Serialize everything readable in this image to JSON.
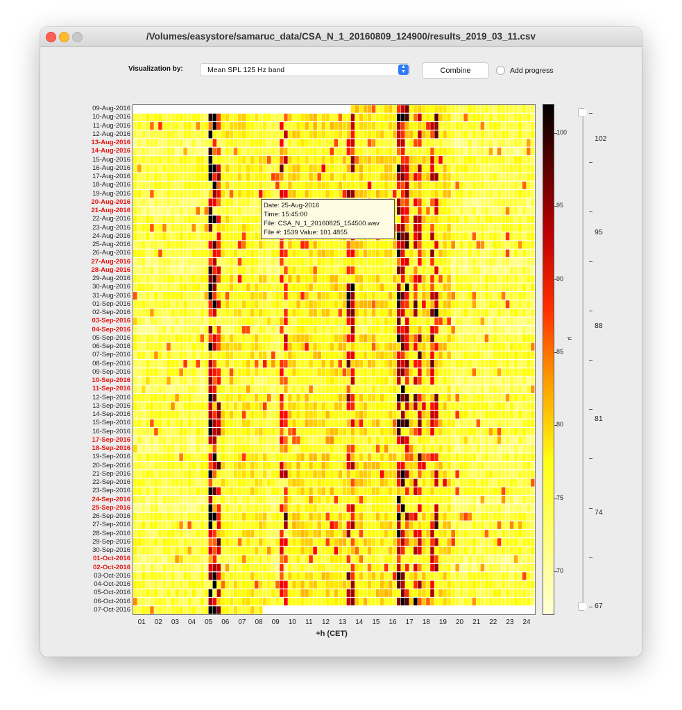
{
  "window": {
    "title": "/Volumes/easystore/samaruc_data/CSA_N_1_20160809_124900/results_2019_03_11.csv"
  },
  "controls": {
    "visualization_label": "Visualization by:",
    "visualization_selected": "Mean SPL 125 Hz band",
    "combine_label": "Combine",
    "add_progress_label": "Add progress",
    "add_progress_checked": false
  },
  "tooltip": {
    "date": "Date: 25-Aug-2016",
    "time": "Time: 15:45:00",
    "file": "File: CSA_N_1_20160825_154500.wav",
    "file_num": "File #: 1539 Value: 101.4855"
  },
  "colorbar": {
    "axis_title": "μ"
  },
  "slider": {
    "labels": [
      "102",
      "95",
      "88",
      "81",
      "74",
      "67"
    ]
  },
  "colors": {
    "weekend_label": "#e8130d"
  },
  "chart_data": {
    "type": "heatmap",
    "title": "",
    "xlabel": "+h (CET)",
    "ylabel": "",
    "x_ticks": [
      "01",
      "02",
      "03",
      "04",
      "05",
      "06",
      "07",
      "08",
      "09",
      "10",
      "11",
      "12",
      "13",
      "14",
      "15",
      "16",
      "17",
      "18",
      "19",
      "20",
      "21",
      "22",
      "23",
      "24"
    ],
    "rows": [
      {
        "label": "09-Aug-2016",
        "weekend": false
      },
      {
        "label": "10-Aug-2016",
        "weekend": false
      },
      {
        "label": "11-Aug-2016",
        "weekend": false
      },
      {
        "label": "12-Aug-2016",
        "weekend": false
      },
      {
        "label": "13-Aug-2016",
        "weekend": true
      },
      {
        "label": "14-Aug-2016",
        "weekend": true
      },
      {
        "label": "15-Aug-2016",
        "weekend": false
      },
      {
        "label": "16-Aug-2016",
        "weekend": false
      },
      {
        "label": "17-Aug-2016",
        "weekend": false
      },
      {
        "label": "18-Aug-2016",
        "weekend": false
      },
      {
        "label": "19-Aug-2016",
        "weekend": false
      },
      {
        "label": "20-Aug-2016",
        "weekend": true
      },
      {
        "label": "21-Aug-2016",
        "weekend": true
      },
      {
        "label": "22-Aug-2016",
        "weekend": false
      },
      {
        "label": "23-Aug-2016",
        "weekend": false
      },
      {
        "label": "24-Aug-2016",
        "weekend": false
      },
      {
        "label": "25-Aug-2016",
        "weekend": false
      },
      {
        "label": "26-Aug-2016",
        "weekend": false
      },
      {
        "label": "27-Aug-2016",
        "weekend": true
      },
      {
        "label": "28-Aug-2016",
        "weekend": true
      },
      {
        "label": "29-Aug-2016",
        "weekend": false
      },
      {
        "label": "30-Aug-2016",
        "weekend": false
      },
      {
        "label": "31-Aug-2016",
        "weekend": false
      },
      {
        "label": "01-Sep-2016",
        "weekend": false
      },
      {
        "label": "02-Sep-2016",
        "weekend": false
      },
      {
        "label": "03-Sep-2016",
        "weekend": true
      },
      {
        "label": "04-Sep-2016",
        "weekend": true
      },
      {
        "label": "05-Sep-2016",
        "weekend": false
      },
      {
        "label": "06-Sep-2016",
        "weekend": false
      },
      {
        "label": "07-Sep-2016",
        "weekend": false
      },
      {
        "label": "08-Sep-2016",
        "weekend": false
      },
      {
        "label": "09-Sep-2016",
        "weekend": false
      },
      {
        "label": "10-Sep-2016",
        "weekend": true
      },
      {
        "label": "11-Sep-2016",
        "weekend": true
      },
      {
        "label": "12-Sep-2016",
        "weekend": false
      },
      {
        "label": "13-Sep-2016",
        "weekend": false
      },
      {
        "label": "14-Sep-2016",
        "weekend": false
      },
      {
        "label": "15-Sep-2016",
        "weekend": false
      },
      {
        "label": "16-Sep-2016",
        "weekend": false
      },
      {
        "label": "17-Sep-2016",
        "weekend": true
      },
      {
        "label": "18-Sep-2016",
        "weekend": true
      },
      {
        "label": "19-Sep-2016",
        "weekend": false
      },
      {
        "label": "20-Sep-2016",
        "weekend": false
      },
      {
        "label": "21-Sep-2016",
        "weekend": false
      },
      {
        "label": "22-Sep-2016",
        "weekend": false
      },
      {
        "label": "23-Sep-2016",
        "weekend": false
      },
      {
        "label": "24-Sep-2016",
        "weekend": true
      },
      {
        "label": "25-Sep-2016",
        "weekend": true
      },
      {
        "label": "26-Sep-2016",
        "weekend": false
      },
      {
        "label": "27-Sep-2016",
        "weekend": false
      },
      {
        "label": "28-Sep-2016",
        "weekend": false
      },
      {
        "label": "29-Sep-2016",
        "weekend": false
      },
      {
        "label": "30-Sep-2016",
        "weekend": false
      },
      {
        "label": "01-Oct-2016",
        "weekend": true
      },
      {
        "label": "02-Oct-2016",
        "weekend": true
      },
      {
        "label": "03-Oct-2016",
        "weekend": false
      },
      {
        "label": "04-Oct-2016",
        "weekend": false
      },
      {
        "label": "05-Oct-2016",
        "weekend": false
      },
      {
        "label": "06-Oct-2016",
        "weekend": false
      },
      {
        "label": "07-Oct-2016",
        "weekend": false
      }
    ],
    "colorbar": {
      "ticks": [
        70,
        75,
        80,
        85,
        90,
        95,
        100
      ],
      "range": [
        67,
        102
      ]
    },
    "data_start_hour": 12.8,
    "data_end_hour": 7.5,
    "notable_high_hours": [
      4.6,
      4.8,
      8.9,
      12.9,
      15.8,
      16.0,
      16.9,
      17.9
    ],
    "notable_value": {
      "date": "25-Aug-2016",
      "time": "15:45:00",
      "value": 101.4855
    }
  }
}
